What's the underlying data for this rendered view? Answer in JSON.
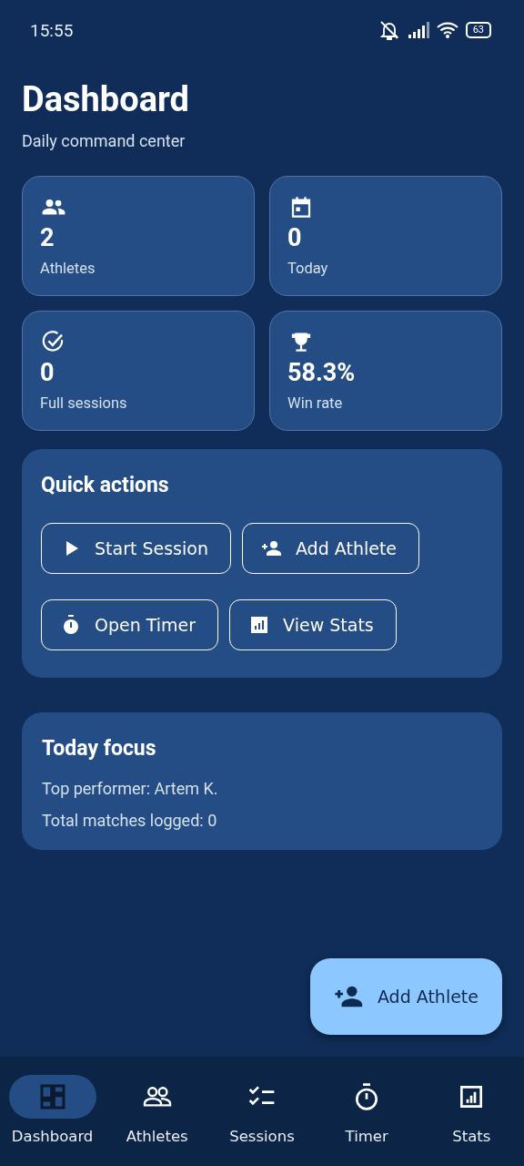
{
  "status_bar": {
    "time": "15:55",
    "battery": "63"
  },
  "header": {
    "title": "Dashboard",
    "subtitle": "Daily command center"
  },
  "stats": [
    {
      "value": "2",
      "label": "Athletes"
    },
    {
      "value": "0",
      "label": "Today"
    },
    {
      "value": "0",
      "label": "Full sessions"
    },
    {
      "value": "58.3%",
      "label": "Win rate"
    }
  ],
  "quick_actions": {
    "title": "Quick actions",
    "rows": [
      [
        "Start Session",
        "Add Athlete"
      ],
      [
        "Open Timer",
        "View Stats"
      ]
    ]
  },
  "today_focus": {
    "title": "Today focus",
    "lines": [
      "Top performer: Artem K.",
      "Total matches logged: 0"
    ]
  },
  "fab": {
    "label": "Add Athlete"
  },
  "nav": [
    {
      "label": "Dashboard",
      "selected": true
    },
    {
      "label": "Athletes",
      "selected": false
    },
    {
      "label": "Sessions",
      "selected": false
    },
    {
      "label": "Timer",
      "selected": false
    },
    {
      "label": "Stats",
      "selected": false
    }
  ]
}
